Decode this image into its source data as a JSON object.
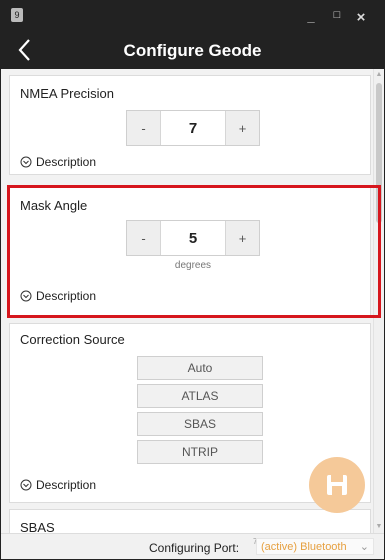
{
  "window": {
    "icon_label": "9",
    "minimize": "_",
    "maximize": "□",
    "close": "×"
  },
  "header": {
    "title": "Configure Geode"
  },
  "nmea": {
    "label": "NMEA Precision",
    "minus": "-",
    "value": "7",
    "plus": "+",
    "description": "Description"
  },
  "mask": {
    "label": "Mask Angle",
    "minus": "-",
    "value": "5",
    "plus": "+",
    "unit": "degrees",
    "description": "Description"
  },
  "correction": {
    "label": "Correction Source",
    "options": [
      "Auto",
      "ATLAS",
      "SBAS",
      "NTRIP"
    ],
    "description": "Description"
  },
  "next_section": {
    "label": "SBAS"
  },
  "footer": {
    "port_label": "Configuring Port:",
    "port_superscript": "7",
    "port_value": "(active) Bluetooth",
    "chevron": "⌄"
  },
  "colors": {
    "highlight": "#d6161d",
    "accent": "#f5c999",
    "port_text": "#e6a040",
    "titlebar": "#222222"
  }
}
